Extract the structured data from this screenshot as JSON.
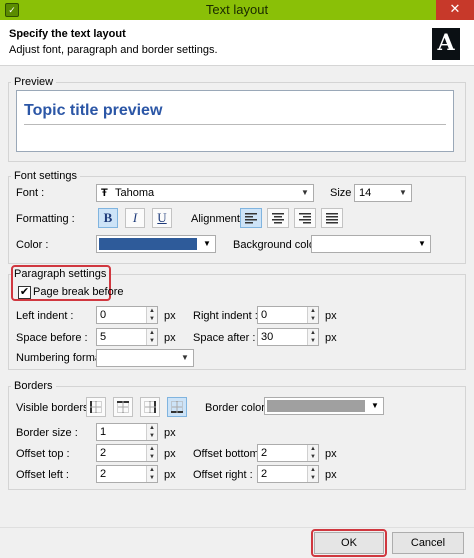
{
  "window": {
    "title": "Text layout",
    "app_icon": "leaf-app-icon",
    "close_glyph": "✕"
  },
  "header": {
    "title": "Specify the text layout",
    "subtitle": "Adjust font, paragraph and border settings.",
    "logo_letter": "A"
  },
  "preview": {
    "group_title": "Preview",
    "text": "Topic title preview"
  },
  "font_settings": {
    "group_title": "Font settings",
    "font_label": "Font :",
    "font_value": "Tahoma",
    "font_glyph": "Ŧ",
    "size_label": "Size :",
    "size_value": "14",
    "formatting_label": "Formatting :",
    "bold": "B",
    "italic": "I",
    "underline": "U",
    "alignment_label": "Alignment :",
    "alignment_selected": "left",
    "color_label": "Color :",
    "color_value": "#2e5b9a",
    "background_color_label": "Background color :",
    "background_color_value": "#ffffff"
  },
  "paragraph_settings": {
    "group_title": "Paragraph settings",
    "page_break_label": "Page break before",
    "page_break_checked": true,
    "left_indent_label": "Left indent :",
    "left_indent_value": "0",
    "right_indent_label": "Right indent :",
    "right_indent_value": "0",
    "space_before_label": "Space before :",
    "space_before_value": "5",
    "space_after_label": "Space after :",
    "space_after_value": "30",
    "numbering_label": "Numbering format :",
    "numbering_value": "",
    "unit": "px"
  },
  "borders": {
    "group_title": "Borders",
    "visible_label": "Visible borders :",
    "border_color_label": "Border color :",
    "border_color_value": "#a0a0a0",
    "border_size_label": "Border size :",
    "border_size_value": "1",
    "offset_top_label": "Offset top :",
    "offset_top_value": "2",
    "offset_bottom_label": "Offset bottom :",
    "offset_bottom_value": "2",
    "offset_left_label": "Offset left :",
    "offset_left_value": "2",
    "offset_right_label": "Offset right :",
    "offset_right_value": "2",
    "unit": "px"
  },
  "footer": {
    "ok": "OK",
    "cancel": "Cancel"
  }
}
